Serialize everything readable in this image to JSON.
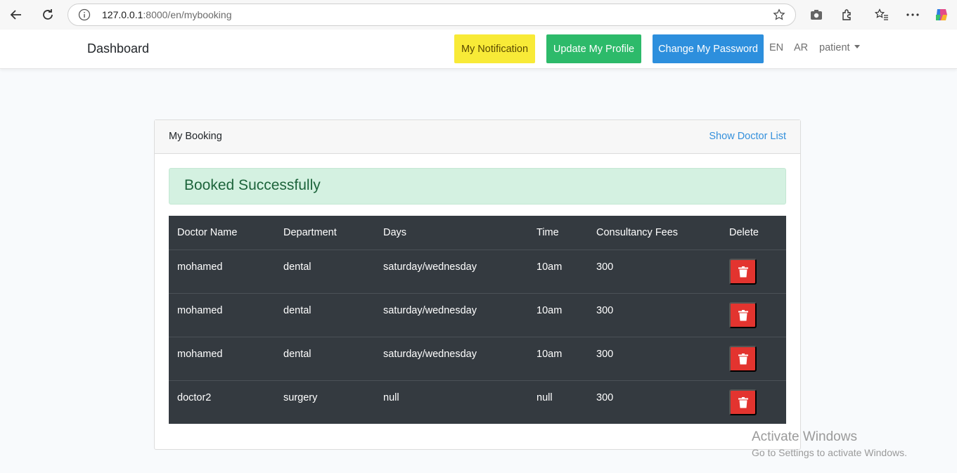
{
  "browser": {
    "url_host": "127.0.0.1",
    "url_path": ":8000/en/mybooking"
  },
  "navbar": {
    "brand": "Dashboard",
    "notification_label": "My Notification",
    "profile_label": "Update My Profile",
    "password_label": "Change My Password",
    "lang_en": "EN",
    "lang_ar": "AR",
    "user": "patient"
  },
  "card": {
    "title": "My Booking",
    "link": "Show Doctor List",
    "alert": "Booked Successfully"
  },
  "table": {
    "headers": [
      "Doctor Name",
      "Department",
      "Days",
      "Time",
      "Consultancy Fees",
      "Delete"
    ],
    "rows": [
      [
        "mohamed",
        "dental",
        "saturday/wednesday",
        "10am",
        "300"
      ],
      [
        "mohamed",
        "dental",
        "saturday/wednesday",
        "10am",
        "300"
      ],
      [
        "mohamed",
        "dental",
        "saturday/wednesday",
        "10am",
        "300"
      ],
      [
        "doctor2",
        "surgery",
        "null",
        "null",
        "300"
      ]
    ]
  },
  "colors": {
    "notification": "#f8ea37",
    "profile": "#2dba6a",
    "password": "#2d8fdd",
    "table_bg": "#343a40",
    "delete": "#e3342f",
    "alert_bg": "#d4f1e1"
  },
  "watermark": {
    "title": "Activate Windows",
    "subtitle": "Go to Settings to activate Windows."
  }
}
